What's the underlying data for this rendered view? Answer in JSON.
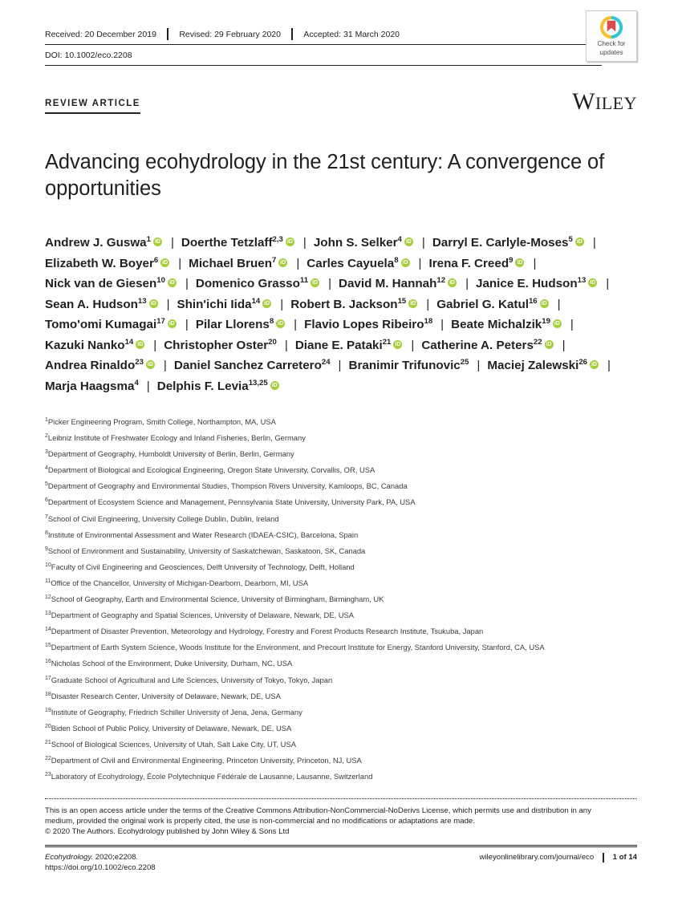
{
  "header": {
    "received": "Received: 20 December 2019",
    "revised": "Revised: 29 February 2020",
    "accepted": "Accepted: 31 March 2020",
    "doi": "DOI: 10.1002/eco.2208",
    "badge_line1": "Check for",
    "badge_line2": "updates",
    "badge_ring_color_top": "#f2c230",
    "badge_ring_color_bottom": "#35c4d7",
    "badge_bookmark_color": "#d94a4a"
  },
  "kicker": "REVIEW ARTICLE",
  "publisher": "WILEY",
  "title": "Advancing ecohydrology in the 21st century: A convergence of opportunities",
  "orcid_color": "#a6ce39",
  "authors": [
    {
      "name": "Andrew J. Guswa",
      "sup": "1",
      "orcid": true
    },
    {
      "name": "Doerthe Tetzlaff",
      "sup": "2,3",
      "orcid": true
    },
    {
      "name": "John S. Selker",
      "sup": "4",
      "orcid": true
    },
    {
      "name": "Darryl E. Carlyle-Moses",
      "sup": "5",
      "orcid": true
    },
    {
      "name": "Elizabeth W. Boyer",
      "sup": "6",
      "orcid": true
    },
    {
      "name": "Michael Bruen",
      "sup": "7",
      "orcid": true
    },
    {
      "name": "Carles Cayuela",
      "sup": "8",
      "orcid": true
    },
    {
      "name": "Irena F. Creed",
      "sup": "9",
      "orcid": true
    },
    {
      "name": "Nick van de Giesen",
      "sup": "10",
      "orcid": true
    },
    {
      "name": "Domenico Grasso",
      "sup": "11",
      "orcid": true
    },
    {
      "name": "David M. Hannah",
      "sup": "12",
      "orcid": true
    },
    {
      "name": "Janice E. Hudson",
      "sup": "13",
      "orcid": true
    },
    {
      "name": "Sean A. Hudson",
      "sup": "13",
      "orcid": true
    },
    {
      "name": "Shin'ichi Iida",
      "sup": "14",
      "orcid": true
    },
    {
      "name": "Robert B. Jackson",
      "sup": "15",
      "orcid": true
    },
    {
      "name": "Gabriel G. Katul",
      "sup": "16",
      "orcid": true
    },
    {
      "name": "Tomo'omi Kumagai",
      "sup": "17",
      "orcid": true
    },
    {
      "name": "Pilar Llorens",
      "sup": "8",
      "orcid": true
    },
    {
      "name": "Flavio Lopes Ribeiro",
      "sup": "18",
      "orcid": false
    },
    {
      "name": "Beate Michalzik",
      "sup": "19",
      "orcid": true
    },
    {
      "name": "Kazuki Nanko",
      "sup": "14",
      "orcid": true
    },
    {
      "name": "Christopher Oster",
      "sup": "20",
      "orcid": false
    },
    {
      "name": "Diane E. Pataki",
      "sup": "21",
      "orcid": true
    },
    {
      "name": "Catherine A. Peters",
      "sup": "22",
      "orcid": true
    },
    {
      "name": "Andrea Rinaldo",
      "sup": "23",
      "orcid": true
    },
    {
      "name": "Daniel Sanchez Carretero",
      "sup": "24",
      "orcid": false
    },
    {
      "name": "Branimir Trifunovic",
      "sup": "25",
      "orcid": false
    },
    {
      "name": "Maciej Zalewski",
      "sup": "26",
      "orcid": true
    },
    {
      "name": "Marja Haagsma",
      "sup": "4",
      "orcid": false
    },
    {
      "name": "Delphis F. Levia",
      "sup": "13,25",
      "orcid": true
    }
  ],
  "author_separator": "|",
  "affiliations": [
    {
      "num": "1",
      "text": "Picker Engineering Program, Smith College, Northampton, MA, USA"
    },
    {
      "num": "2",
      "text": "Leibniz Institute of Freshwater Ecology and Inland Fisheries, Berlin, Germany"
    },
    {
      "num": "3",
      "text": "Department of Geography, Humboldt University of Berlin, Berlin, Germany"
    },
    {
      "num": "4",
      "text": "Department of Biological and Ecological Engineering, Oregon State University, Corvallis, OR, USA"
    },
    {
      "num": "5",
      "text": "Department of Geography and Environmental Studies, Thompson Rivers University, Kamloops, BC, Canada"
    },
    {
      "num": "6",
      "text": "Department of Ecosystem Science and Management, Pennsylvania State University, University Park, PA, USA"
    },
    {
      "num": "7",
      "text": "School of Civil Engineering, University College Dublin, Dublin, Ireland"
    },
    {
      "num": "8",
      "text": "Institute of Environmental Assessment and Water Research (IDAEA-CSIC), Barcelona, Spain"
    },
    {
      "num": "9",
      "text": "School of Environment and Sustainability, University of Saskatchewan, Saskatoon, SK, Canada"
    },
    {
      "num": "10",
      "text": "Faculty of Civil Engineering and Geosciences, Delft University of Technology, Delft, Holland"
    },
    {
      "num": "11",
      "text": "Office of the Chancellor, University of Michigan-Dearborn, Dearborn, MI, USA"
    },
    {
      "num": "12",
      "text": "School of Geography, Earth and Environmental Science, University of Birmingham, Birmingham, UK"
    },
    {
      "num": "13",
      "text": "Department of Geography and Spatial Sciences, University of Delaware, Newark, DE, USA"
    },
    {
      "num": "14",
      "text": "Department of Disaster Prevention, Meteorology and Hydrology, Forestry and Forest Products Research Institute, Tsukuba, Japan"
    },
    {
      "num": "15",
      "text": "Department of Earth System Science, Woods Institute for the Environment, and Precourt Institute for Energy, Stanford University, Stanford, CA, USA"
    },
    {
      "num": "16",
      "text": "Nicholas School of the Environment, Duke University, Durham, NC, USA"
    },
    {
      "num": "17",
      "text": "Graduate School of Agricultural and Life Sciences, University of Tokyo, Tokyo, Japan"
    },
    {
      "num": "18",
      "text": "Disaster Research Center, University of Delaware, Newark, DE, USA"
    },
    {
      "num": "19",
      "text": "Institute of Geography, Friedrich Schiller University of Jena, Jena, Germany"
    },
    {
      "num": "20",
      "text": "Biden School of Public Policy, University of Delaware, Newark, DE, USA"
    },
    {
      "num": "21",
      "text": "School of Biological Sciences, University of Utah, Salt Lake City, UT, USA"
    },
    {
      "num": "22",
      "text": "Department of Civil and Environmental Engineering, Princeton University, Princeton, NJ, USA"
    },
    {
      "num": "23",
      "text": "Laboratory of Ecohydrology, École Polytechnique Fédérale de Lausanne, Lausanne, Switzerland"
    }
  ],
  "license": {
    "line1": "This is an open access article under the terms of the Creative Commons Attribution-NonCommercial-NoDerivs License, which permits use and distribution in any",
    "line2": "medium, provided the original work is properly cited, the use is non-commercial and no modifications or adaptations are made.",
    "copyright": "© 2020 The Authors. Ecohydrology published by John Wiley & Sons Ltd"
  },
  "footer": {
    "journal_citation": "Ecohydrology.",
    "citation_rest": " 2020;e2208.",
    "doi_url": "https://doi.org/10.1002/eco.2208",
    "journal_url": "wileyonlinelibrary.com/journal/eco",
    "page": "1 of 14"
  }
}
